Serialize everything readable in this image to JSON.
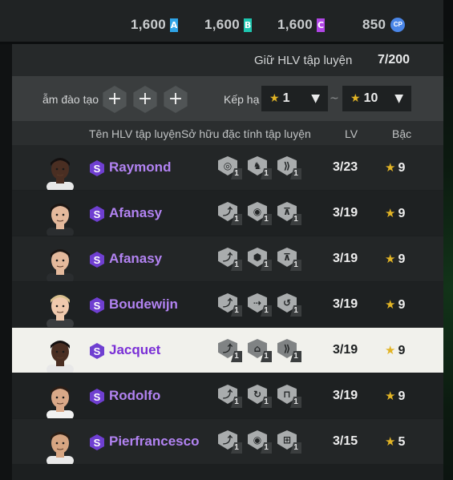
{
  "currencies": [
    {
      "value": "1,600",
      "badge": "A",
      "color": "#2fa4e7"
    },
    {
      "value": "1,600",
      "badge": "B",
      "color": "#1ec7b0"
    },
    {
      "value": "1,600",
      "badge": "C",
      "color": "#b146e6"
    },
    {
      "value": "850",
      "badge": "CP",
      "color": "#4a86e8"
    }
  ],
  "holder": {
    "label": "Giữ HLV tập luyện",
    "count": "7/200"
  },
  "filters": {
    "training_label": "ẫm đào tạo",
    "add_symbol": "+",
    "rank_label": "Kếp hạ",
    "from_value": "1",
    "to_value": "10",
    "separator": "~",
    "star": "★",
    "caret": "▼"
  },
  "columns": {
    "name": "Tên HLV tập luyện",
    "traits": "Sở hữu đặc tính tập luyện",
    "lv": "LV",
    "grade": "Bậc"
  },
  "coaches": [
    {
      "name": "Raymond",
      "lv": "3/23",
      "grade": "9",
      "trait_levels": [
        "1",
        "1",
        "1"
      ],
      "trait_icons": [
        "trait-target-icon",
        "trait-horse-icon",
        "trait-sprint-icon"
      ],
      "skin": "#4a2e22",
      "hair": "#141010",
      "shirt": "#e8e8e8"
    },
    {
      "name": "Afanasy",
      "lv": "3/19",
      "grade": "9",
      "trait_levels": [
        "1",
        "1",
        "1"
      ],
      "trait_icons": [
        "trait-kick-icon",
        "trait-ball-icon",
        "trait-trap-icon"
      ],
      "skin": "#e4b99c",
      "hair": "#1b1512",
      "shirt": "#2a2d2f"
    },
    {
      "name": "Afanasy",
      "lv": "3/19",
      "grade": "9",
      "trait_levels": [
        "1",
        "1",
        "1"
      ],
      "trait_icons": [
        "trait-kick-icon",
        "trait-shield-icon",
        "trait-trap-icon"
      ],
      "skin": "#e4b99c",
      "hair": "#1b1512",
      "shirt": "#2a2d2f"
    },
    {
      "name": "Boudewijn",
      "lv": "3/19",
      "grade": "9",
      "trait_levels": [
        "1",
        "1",
        "1"
      ],
      "trait_icons": [
        "trait-kick-icon",
        "trait-pass-icon",
        "trait-hook-icon"
      ],
      "skin": "#f0c9ad",
      "hair": "#d8c08e",
      "shirt": "#3a3d3f"
    },
    {
      "name": "Jacquet",
      "lv": "3/19",
      "grade": "9",
      "trait_levels": [
        "1",
        "1",
        "1"
      ],
      "trait_icons": [
        "trait-kick-icon",
        "trait-boot-icon",
        "trait-sprint-icon"
      ],
      "skin": "#4a2e22",
      "hair": "#141010",
      "shirt": "#e8e8e8"
    },
    {
      "name": "Rodolfo",
      "lv": "3/19",
      "grade": "9",
      "trait_levels": [
        "1",
        "1",
        "1"
      ],
      "trait_icons": [
        "trait-kick-icon",
        "trait-curl-icon",
        "trait-goal-icon"
      ],
      "skin": "#d9a888",
      "hair": "#2b1d16",
      "shirt": "#f1f1f1"
    },
    {
      "name": "Pierfrancesco",
      "lv": "3/15",
      "grade": "5",
      "trait_levels": [
        "1",
        "1",
        "1"
      ],
      "trait_icons": [
        "trait-kick-icon",
        "trait-ball-icon",
        "trait-grid-icon"
      ],
      "skin": "#d6a582",
      "hair": "#2a1d15",
      "shirt": "#e9e9e9"
    }
  ],
  "selected_index": 4,
  "colors": {
    "name_purple": "#b283f2",
    "selected_name": "#7a2fd6",
    "star_gold": "#e2b425",
    "s_badge": "#6f3fd1"
  }
}
